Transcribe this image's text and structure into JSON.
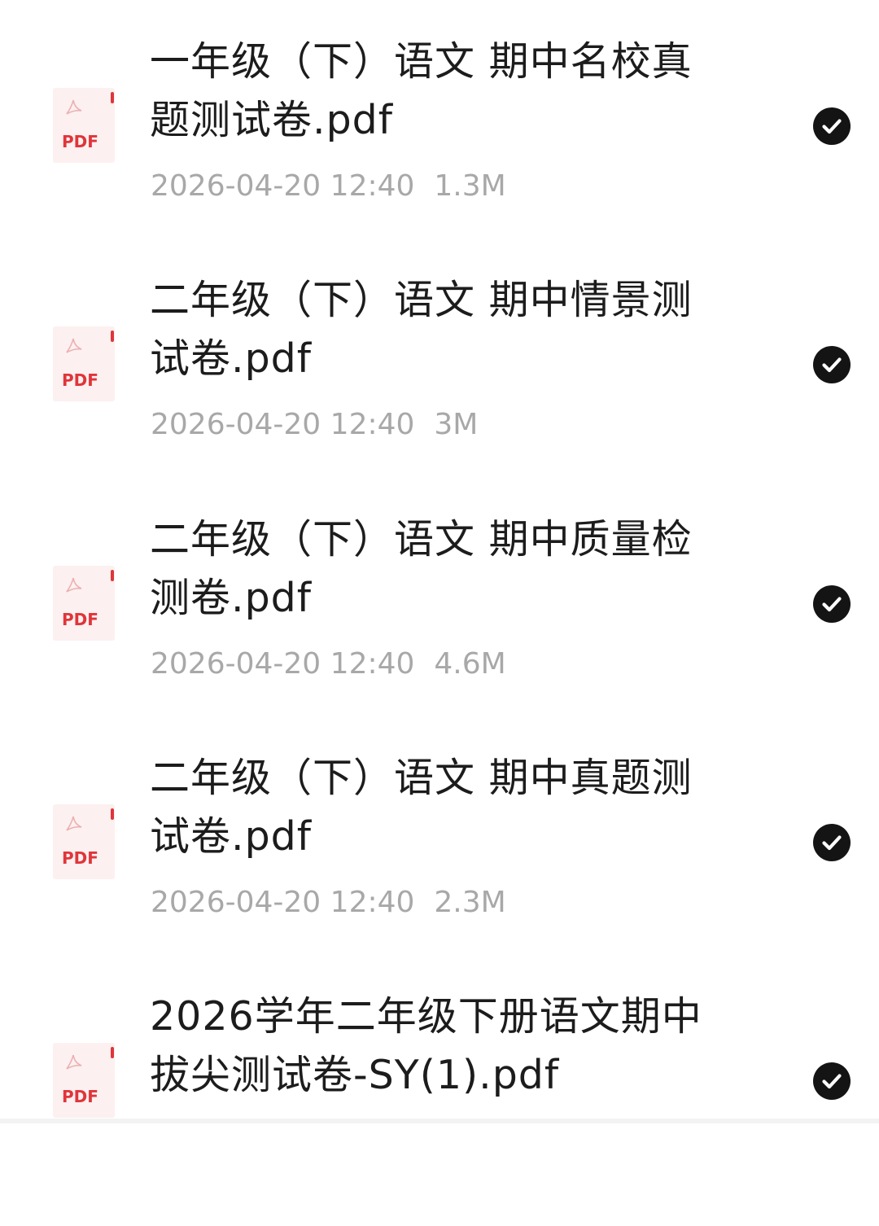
{
  "files": [
    {
      "name": "一年级（下）语文 期中名校真题测试卷.pdf",
      "date": "2026-04-20 12:40",
      "size": "1.3M",
      "type_label": "PDF",
      "selected": true
    },
    {
      "name": "二年级（下）语文 期中情景测试卷.pdf",
      "date": "2026-04-20 12:40",
      "size": "3M",
      "type_label": "PDF",
      "selected": true
    },
    {
      "name": "二年级（下）语文 期中质量检测卷.pdf",
      "date": "2026-04-20 12:40",
      "size": "4.6M",
      "type_label": "PDF",
      "selected": true
    },
    {
      "name": "二年级（下）语文 期中真题测试卷.pdf",
      "date": "2026-04-20 12:40",
      "size": "2.3M",
      "type_label": "PDF",
      "selected": true
    },
    {
      "name": "2026学年二年级下册语文期中拔尖测试卷-SY(1).pdf",
      "date": "",
      "size": "",
      "type_label": "PDF",
      "selected": true
    }
  ],
  "icons": {
    "file": "pdf-file-icon",
    "check": "checkmark-circle-icon"
  },
  "colors": {
    "pdf_red": "#e0353a",
    "pdf_bg": "#fcf0f0",
    "title_text": "#1c1c1c",
    "meta_text": "#a8a8a8",
    "check_bg": "#141414"
  }
}
